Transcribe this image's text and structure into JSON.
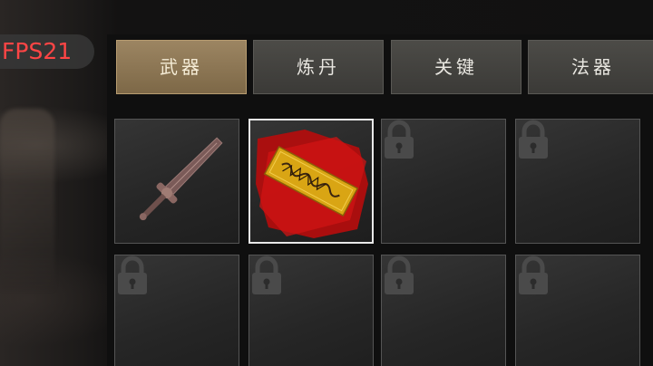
{
  "hud": {
    "fps_text": "FPS21",
    "fps_color": "#ff4545"
  },
  "tabs": [
    {
      "label": "武器",
      "active": true
    },
    {
      "label": "炼丹",
      "active": false
    },
    {
      "label": "关键",
      "active": false
    },
    {
      "label": "法器",
      "active": false
    }
  ],
  "inventory": {
    "slots": [
      {
        "item": "sword-icon",
        "locked": false,
        "selected": false
      },
      {
        "item": "golden-scroll-icon",
        "locked": false,
        "selected": true
      },
      {
        "item": null,
        "locked": true,
        "selected": false
      },
      {
        "item": null,
        "locked": true,
        "selected": false
      },
      {
        "item": null,
        "locked": true,
        "selected": false
      },
      {
        "item": null,
        "locked": true,
        "selected": false
      },
      {
        "item": null,
        "locked": true,
        "selected": false
      },
      {
        "item": null,
        "locked": true,
        "selected": false
      }
    ]
  },
  "colors": {
    "active_tab": "#8d7653",
    "inactive_tab": "#43423e",
    "scroll_gold": "#d9a514",
    "scroll_red": "#c41010"
  }
}
